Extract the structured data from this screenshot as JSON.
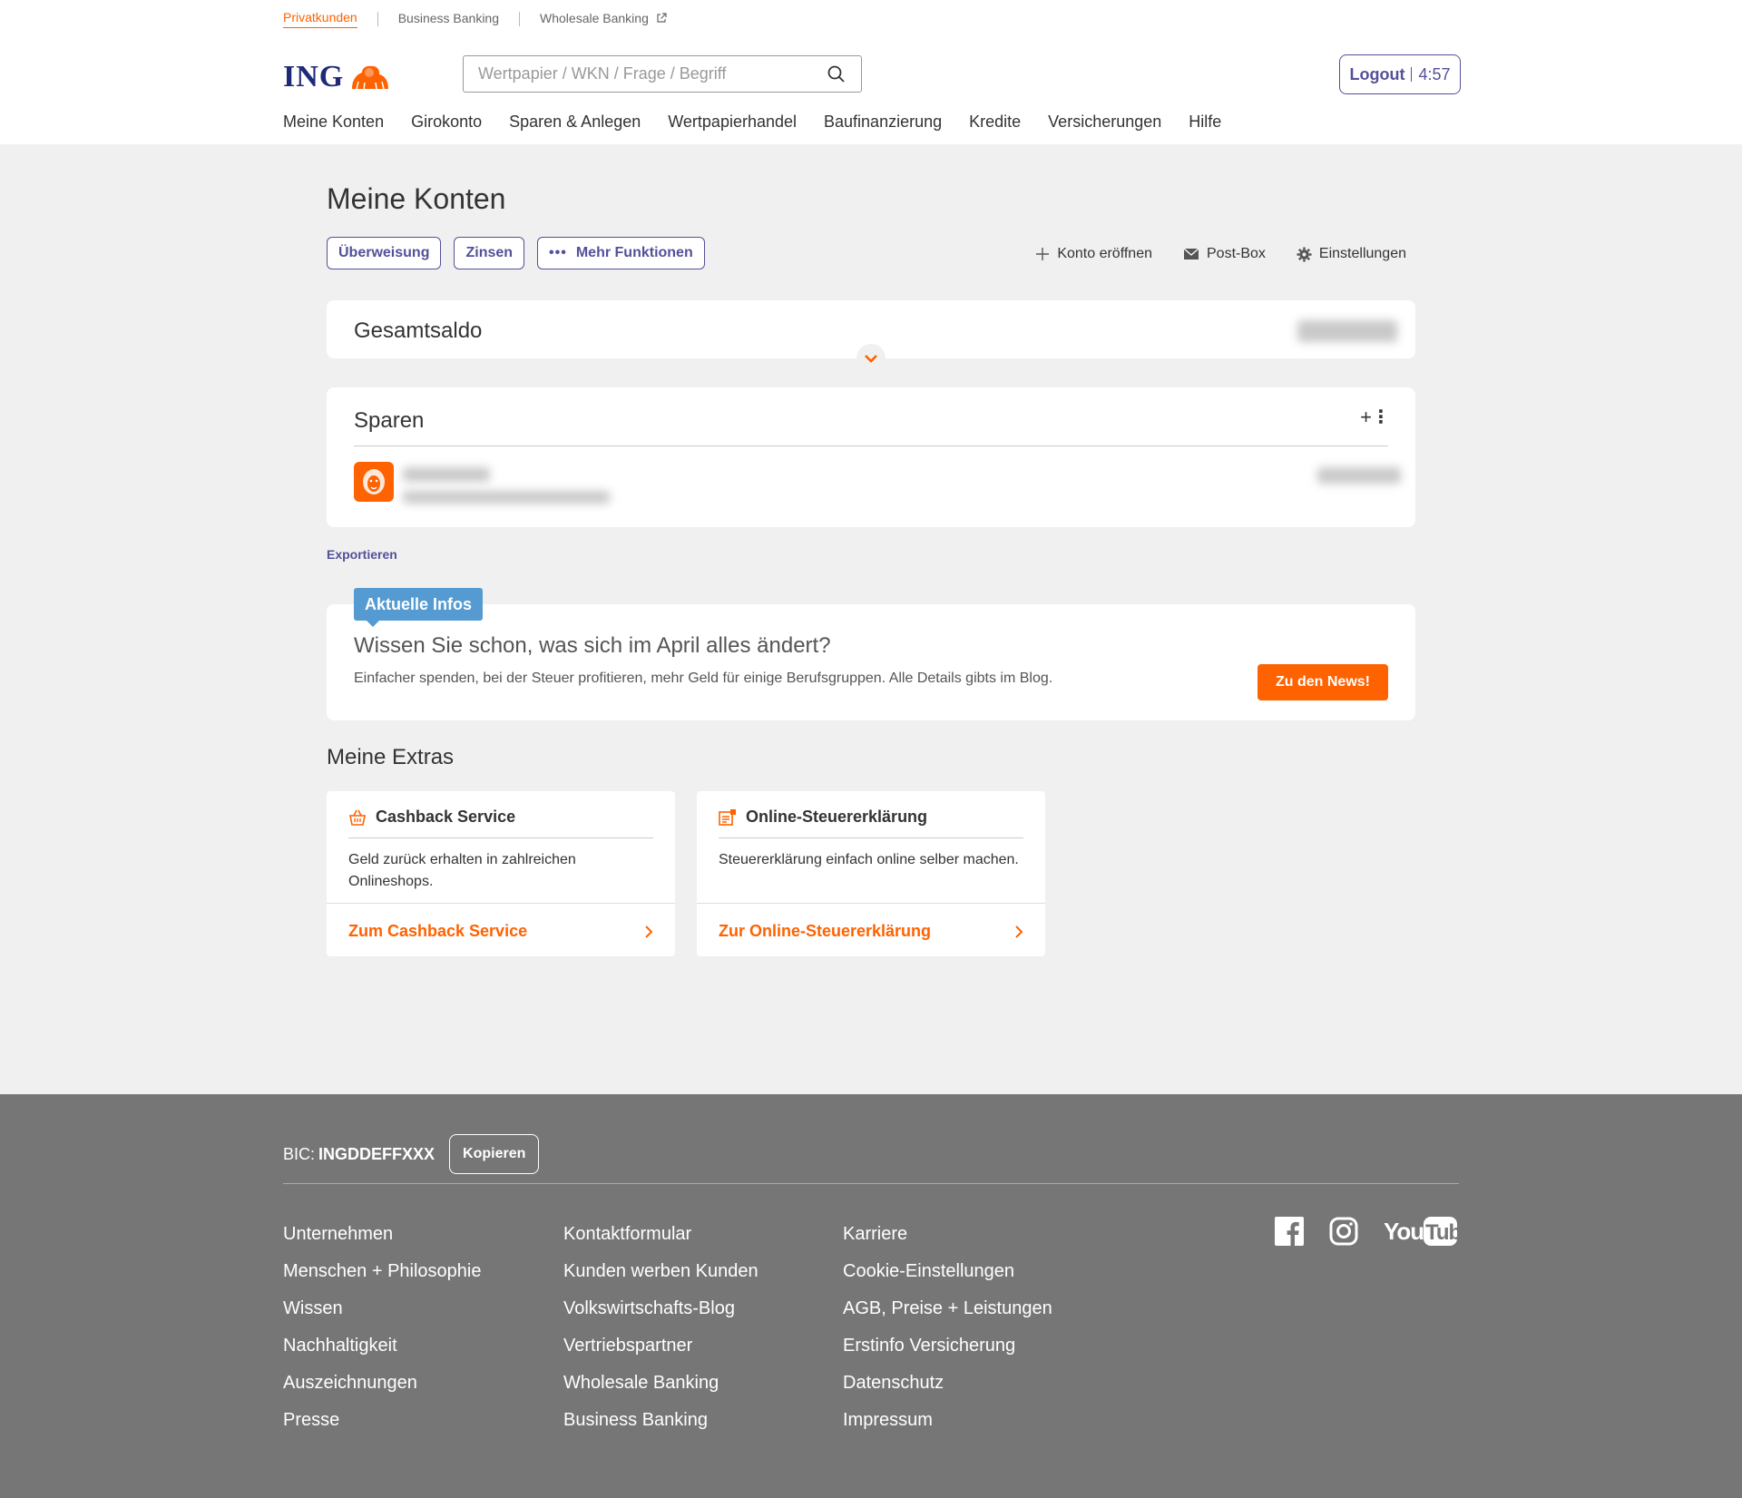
{
  "segments": {
    "privat": "Privatkunden",
    "business": "Business Banking",
    "wholesale": "Wholesale Banking"
  },
  "brand": {
    "logo_text": "ING",
    "orange": "#ff6200",
    "indigo": "#525199"
  },
  "search": {
    "placeholder": "Wertpapier / WKN / Frage / Begriff"
  },
  "logout": {
    "label": "Logout",
    "timer": "4:57"
  },
  "nav": [
    "Meine Konten",
    "Girokonto",
    "Sparen & Anlegen",
    "Wertpapierhandel",
    "Baufinanzierung",
    "Kredite",
    "Versicherungen",
    "Hilfe"
  ],
  "page": {
    "title": "Meine Konten",
    "actions": {
      "transfer": "Überweisung",
      "interest": "Zinsen",
      "more": "Mehr Funktionen"
    },
    "links": {
      "open_account": "Konto eröffnen",
      "postbox": "Post-Box",
      "settings": "Einstellungen"
    }
  },
  "total": {
    "label": "Gesamtsaldo"
  },
  "sparen": {
    "label": "Sparen"
  },
  "export": "Exportieren",
  "infos": {
    "tag": "Aktuelle Infos",
    "headline": "Wissen Sie schon, was sich im April alles ändert?",
    "text": "Einfacher spenden, bei der Steuer profitieren, mehr Geld für einige Berufsgruppen. Alle Details gibts im Blog.",
    "button": "Zu den News!"
  },
  "extras": {
    "title": "Meine Extras",
    "cashback": {
      "title": "Cashback Service",
      "desc": "Geld zurück erhalten in zahlreichen Onlineshops.",
      "link": "Zum Cashback Service",
      "icon": "shopping-basket-icon"
    },
    "tax": {
      "title": "Online-Steuererklärung",
      "desc": "Steuererklärung einfach online selber machen.",
      "link": "Zur Online-Steuererklärung",
      "icon": "tax-document-icon"
    }
  },
  "footer": {
    "bic_label": "BIC:",
    "bic_value": "INGDDEFFXXX",
    "copy": "Kopieren",
    "col1": [
      "Unternehmen",
      "Menschen + Philosophie",
      "Wissen",
      "Nachhaltigkeit",
      "Auszeichnungen",
      "Presse"
    ],
    "col2": [
      "Kontaktformular",
      "Kunden werben Kunden",
      "Volkswirtschafts-Blog",
      "Vertriebspartner",
      "Wholesale Banking",
      "Business Banking"
    ],
    "col3": [
      "Karriere",
      "Cookie-Einstellungen",
      "AGB, Preise + Leistungen",
      "Erstinfo Versicherung",
      "Datenschutz",
      "Impressum"
    ],
    "social": [
      "facebook-icon",
      "instagram-icon",
      "youtube-icon"
    ]
  }
}
